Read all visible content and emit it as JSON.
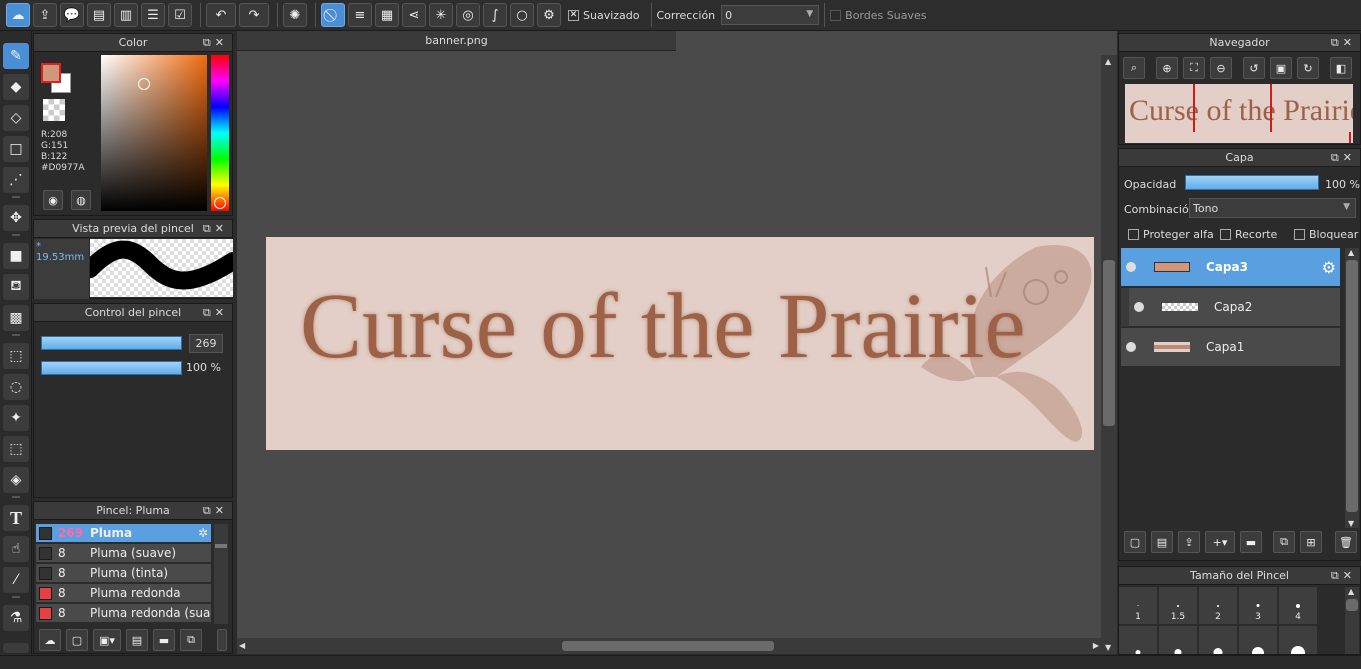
{
  "toolbar": {
    "icons": [
      "cloud-icon",
      "share-icon",
      "speech-bubble-icon",
      "comment-icon",
      "page-icon",
      "list-icon",
      "checklist-icon",
      "undo-icon",
      "redo-icon",
      "loading-icon",
      "prohibit-icon",
      "parallel-ruler-icon",
      "grid-ruler-icon",
      "perspective-icon",
      "radial-icon",
      "concentric-icon",
      "curve-icon",
      "circle-icon",
      "gear-icon"
    ],
    "smoothing_label": "Suavizado",
    "smoothing_checked": true,
    "correction_label": "Corrección",
    "correction_value": "0",
    "soft_edges_label": "Bordes Suaves",
    "soft_edges_checked": false
  },
  "color_panel": {
    "title": "Color",
    "r": "R:208",
    "g": "G:151",
    "b": "B:122",
    "hex": "#D0977A",
    "primary_color": "#D0977A",
    "secondary_color": "#ffffff"
  },
  "brush_preview": {
    "title": "Vista previa del pincel",
    "size": "* 19.53mm"
  },
  "brush_control": {
    "title": "Control del pincel",
    "size_value": "269",
    "opacity_value": "100 %",
    "size_fraction": 1.0,
    "opacity_fraction": 1.0
  },
  "brush_list": {
    "title": "Pincel: Pluma",
    "items": [
      {
        "num": "269",
        "name": "Pluma",
        "color": "#333333",
        "selected": true
      },
      {
        "num": "8",
        "name": "Pluma (suave)",
        "color": "#333333",
        "selected": false
      },
      {
        "num": "8",
        "name": "Pluma (tinta)",
        "color": "#333333",
        "selected": false
      },
      {
        "num": "8",
        "name": "Pluma redonda",
        "color": "#e84040",
        "selected": false
      },
      {
        "num": "8",
        "name": "Pluma redonda (suave",
        "color": "#e84040",
        "selected": false
      }
    ]
  },
  "canvas": {
    "tab_name": "banner.png",
    "banner_text": "Curse of the Prairie",
    "banner_bg": "#e3cfc7",
    "banner_text_color": "#9c6147"
  },
  "navigator": {
    "title": "Navegador",
    "preview_text": "Curse of the Prairie"
  },
  "layers": {
    "title": "Capa",
    "opacity_label": "Opacidad",
    "opacity_value": "100 %",
    "blend_label": "Combinación",
    "blend_value": "Tono",
    "protect_alpha": "Proteger alfa",
    "clipping": "Recorte",
    "lock": "Bloquear",
    "items": [
      {
        "name": "Capa3",
        "selected": true
      },
      {
        "name": "Capa2",
        "selected": false
      },
      {
        "name": "Capa1",
        "selected": false
      }
    ]
  },
  "brush_size": {
    "title": "Tamaño del Pincel",
    "sizes": [
      "1",
      "1.5",
      "2",
      "3",
      "4"
    ]
  }
}
